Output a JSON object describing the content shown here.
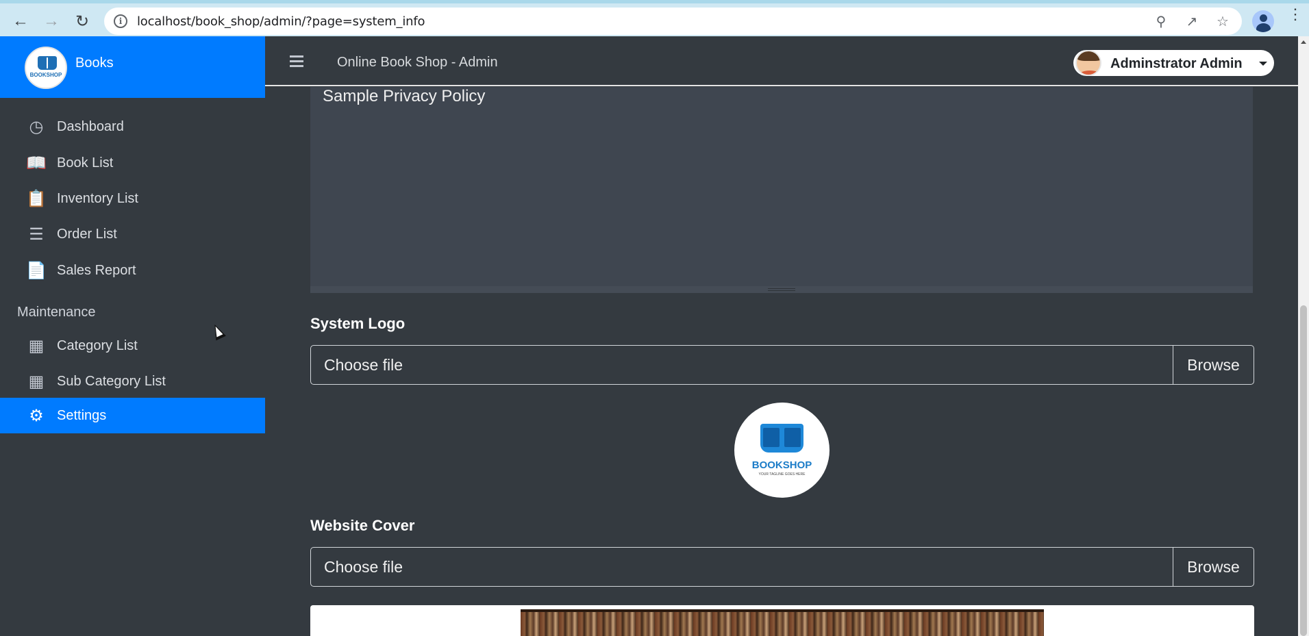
{
  "browser": {
    "url": "localhost/book_shop/admin/?page=system_info"
  },
  "sidebar": {
    "brand": "Books",
    "logo_text": "BOOKSHOP",
    "items": [
      {
        "label": "Dashboard",
        "icon": "tachometer-icon"
      },
      {
        "label": "Book List",
        "icon": "book-open-icon"
      },
      {
        "label": "Inventory List",
        "icon": "clipboard-list-icon"
      },
      {
        "label": "Order List",
        "icon": "list-icon"
      },
      {
        "label": "Sales Report",
        "icon": "file-icon"
      }
    ],
    "section_header": "Maintenance",
    "maintenance_items": [
      {
        "label": "Category List",
        "icon": "table-icon"
      },
      {
        "label": "Sub Category List",
        "icon": "table-icon"
      },
      {
        "label": "Settings",
        "icon": "cogs-icon",
        "active": true
      }
    ]
  },
  "topbar": {
    "title": "Online Book Shop - Admin",
    "user_name": "Adminstrator Admin"
  },
  "main": {
    "privacy_policy_text": "Sample Privacy Policy",
    "system_logo": {
      "label": "System Logo",
      "file_placeholder": "Choose file",
      "browse_label": "Browse",
      "preview_text": "BOOKSHOP",
      "preview_subtext": "YOUR TAGLINE GOES HERE"
    },
    "website_cover": {
      "label": "Website Cover",
      "file_placeholder": "Choose file",
      "browse_label": "Browse"
    }
  },
  "colors": {
    "sidebar_bg": "#343a40",
    "accent": "#007bff",
    "content_bg": "#343a40"
  }
}
